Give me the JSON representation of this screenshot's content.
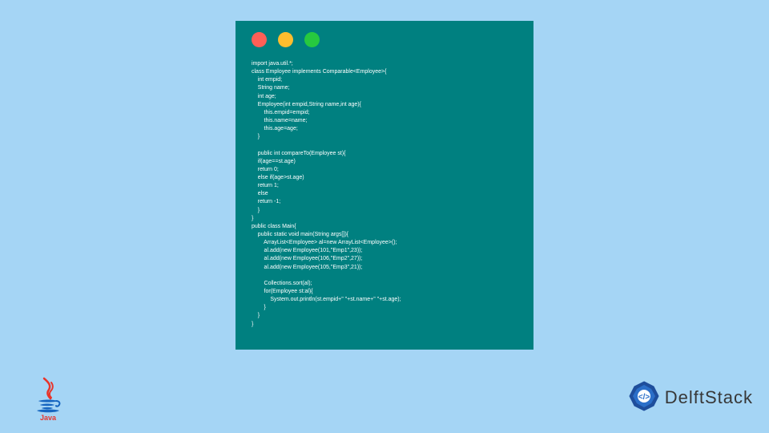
{
  "code": "import java.util.*;\nclass Employee implements Comparable<Employee>{\n    int empid;\n    String name;\n    int age;\n    Employee(int empid,String name,int age){\n        this.empid=empid;\n        this.name=name;\n        this.age=age;\n    }\n\n    public int compareTo(Employee st){\n    if(age==st.age)\n    return 0;\n    else if(age>st.age)\n    return 1;\n    else\n    return -1;\n    }\n}\npublic class Main{\n    public static void main(String args[]){\n        ArrayList<Employee> al=new ArrayList<Employee>();\n        al.add(new Employee(101,\"Emp1\",23));\n        al.add(new Employee(106,\"Emp2\",27));\n        al.add(new Employee(105,\"Emp3\",21));\n\n        Collections.sort(al);\n        for(Employee st:al){\n            System.out.println(st.empid+\" \"+st.name+\" \"+st.age);\n        }\n    }\n}",
  "brand": {
    "name": "DelftStack"
  },
  "logo": {
    "java": "Java"
  }
}
